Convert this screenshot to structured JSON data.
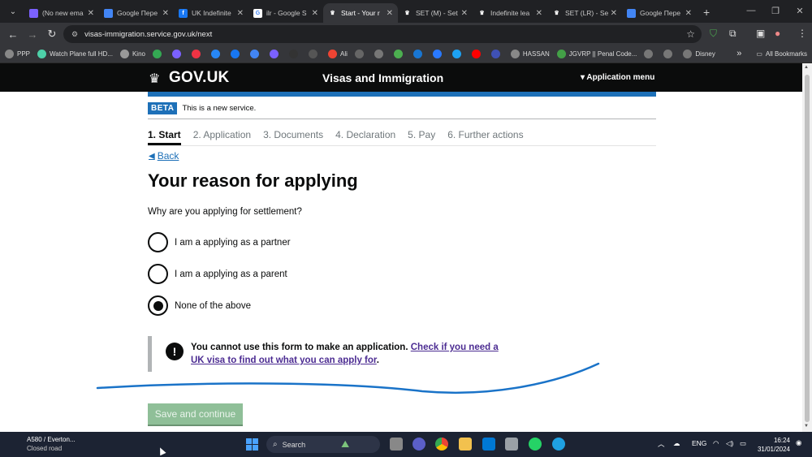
{
  "browser": {
    "tabs": [
      {
        "title": "(No new ema",
        "color": "#7b61ff",
        "icon": "mail-icon",
        "active": false
      },
      {
        "title": "Google Пере",
        "color": "#4285f4",
        "icon": "translate-icon",
        "active": false
      },
      {
        "title": "UK Indefinite",
        "color": "#1877f2",
        "icon": "facebook-icon",
        "active": false
      },
      {
        "title": "ilr - Google S",
        "color": "#ffffff",
        "icon": "google-icon",
        "active": false
      },
      {
        "title": "Start - Your r",
        "color": "#ffffff",
        "icon": "gov-crown-icon",
        "active": true
      },
      {
        "title": "SET (M) - Set",
        "color": "#ffffff",
        "icon": "gov-crown-icon",
        "active": false
      },
      {
        "title": "Indefinite lea",
        "color": "#ffffff",
        "icon": "gov-crown-icon",
        "active": false
      },
      {
        "title": "SET (LR) - Set",
        "color": "#ffffff",
        "icon": "gov-crown-icon",
        "active": false
      },
      {
        "title": "Google Пере",
        "color": "#4285f4",
        "icon": "translate-icon",
        "active": false
      }
    ],
    "url": "visas-immigration.service.gov.uk/next",
    "bookmarks": [
      {
        "label": "PPP",
        "color": "#888"
      },
      {
        "label": "Watch Plane full HD...",
        "color": "#4dd0a8"
      },
      {
        "label": "Kino",
        "color": "#999"
      },
      {
        "label": "",
        "color": "#34a853"
      },
      {
        "label": "",
        "color": "#7b61ff"
      },
      {
        "label": "",
        "color": "#e34"
      },
      {
        "label": "",
        "color": "#2787f5"
      },
      {
        "label": "",
        "color": "#1877f2"
      },
      {
        "label": "",
        "color": "#4285f4"
      },
      {
        "label": "",
        "color": "#7b61ff"
      },
      {
        "label": "",
        "color": "#333"
      },
      {
        "label": "",
        "color": "#555"
      },
      {
        "label": "Ali",
        "color": "#e43"
      },
      {
        "label": "",
        "color": "#666"
      },
      {
        "label": "",
        "color": "#777"
      },
      {
        "label": "",
        "color": "#4caf50"
      },
      {
        "label": "",
        "color": "#1976d2"
      },
      {
        "label": "",
        "color": "#2979ff"
      },
      {
        "label": "",
        "color": "#1da1f2"
      },
      {
        "label": "",
        "color": "#ff0000"
      },
      {
        "label": "",
        "color": "#3f51b5"
      },
      {
        "label": "HASSAN",
        "color": "#888",
        "icon": "folder-icon"
      },
      {
        "label": "JGVRP || Penal Code...",
        "color": "#43a047"
      },
      {
        "label": "",
        "color": "#777"
      },
      {
        "label": "",
        "color": "#777"
      },
      {
        "label": "Disney",
        "color": "#777"
      }
    ],
    "all_bookmarks": "All Bookmarks",
    "more": "»"
  },
  "gov": {
    "logo": "GOV.UK",
    "service_name": "Visas and Immigration",
    "app_menu": "▾ Application menu",
    "beta_tag": "BETA",
    "beta_text": "This is a new service.",
    "steps": [
      "1. Start",
      "2. Application",
      "3. Documents",
      "4. Declaration",
      "5. Pay",
      "6. Further actions"
    ],
    "active_step": 0,
    "back": "Back",
    "heading": "Your reason for applying",
    "question": "Why are you applying for settlement?",
    "options": [
      {
        "label": "I am a applying as a partner",
        "checked": false
      },
      {
        "label": "I am a applying as a parent",
        "checked": false
      },
      {
        "label": "None of the above",
        "checked": true
      }
    ],
    "warning_text": "You cannot use this form to make an application.",
    "warning_link": "Check if you need a UK visa to find out what you can apply for",
    "warning_end": ".",
    "save_button": "Save and continue"
  },
  "taskbar": {
    "weather_title": "A580 / Everton...",
    "weather_sub": "Closed road",
    "search": "Search",
    "lang": "ENG",
    "time": "16:24",
    "date": "31/01/2024"
  },
  "colors": {
    "gov_blue": "#1d70b8",
    "gov_black": "#0b0c0c",
    "link_visited": "#4c2c92",
    "save_disabled": "#8fbf98",
    "scribble": "#1a73c8"
  }
}
